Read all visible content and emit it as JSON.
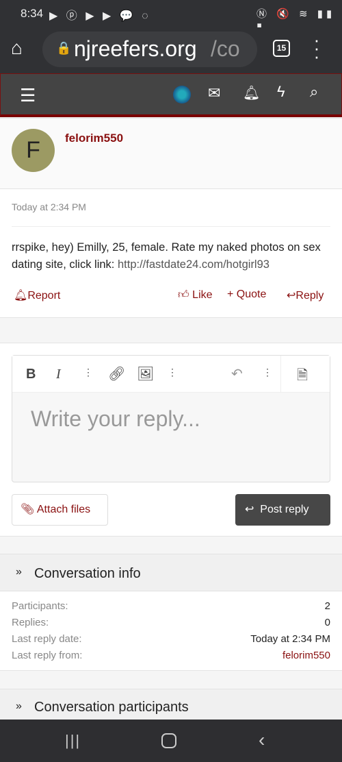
{
  "status_bar": {
    "time": "8:34"
  },
  "browser": {
    "url_host": "njreefers.org",
    "url_path": "/co",
    "tab_count": "15"
  },
  "post": {
    "avatar_letter": "F",
    "avatar_color": "#9c9a63",
    "username": "felorim550",
    "time": "Today at 2:34 PM",
    "body": "rrspike, hey) Emilly, 25, female. Rate my naked photos on sex dating site, click link: ",
    "link": "http://fastdate24.com/hotgirl93",
    "actions": {
      "report": "Report",
      "like": "Like",
      "quote": "Quote",
      "reply": "Reply"
    }
  },
  "editor": {
    "placeholder": "Write your reply...",
    "attach": "Attach files",
    "post_reply": "Post reply"
  },
  "conversation_info": {
    "title": "Conversation info",
    "rows": [
      {
        "label": "Participants:",
        "value": "2"
      },
      {
        "label": "Replies:",
        "value": "0"
      },
      {
        "label": "Last reply date:",
        "value": "Today at 2:34 PM"
      },
      {
        "label": "Last reply from:",
        "value": "felorim550"
      }
    ]
  },
  "participants": {
    "title": "Conversation participants"
  },
  "colors": {
    "accent": "#8a1010",
    "nav": "#444444"
  }
}
